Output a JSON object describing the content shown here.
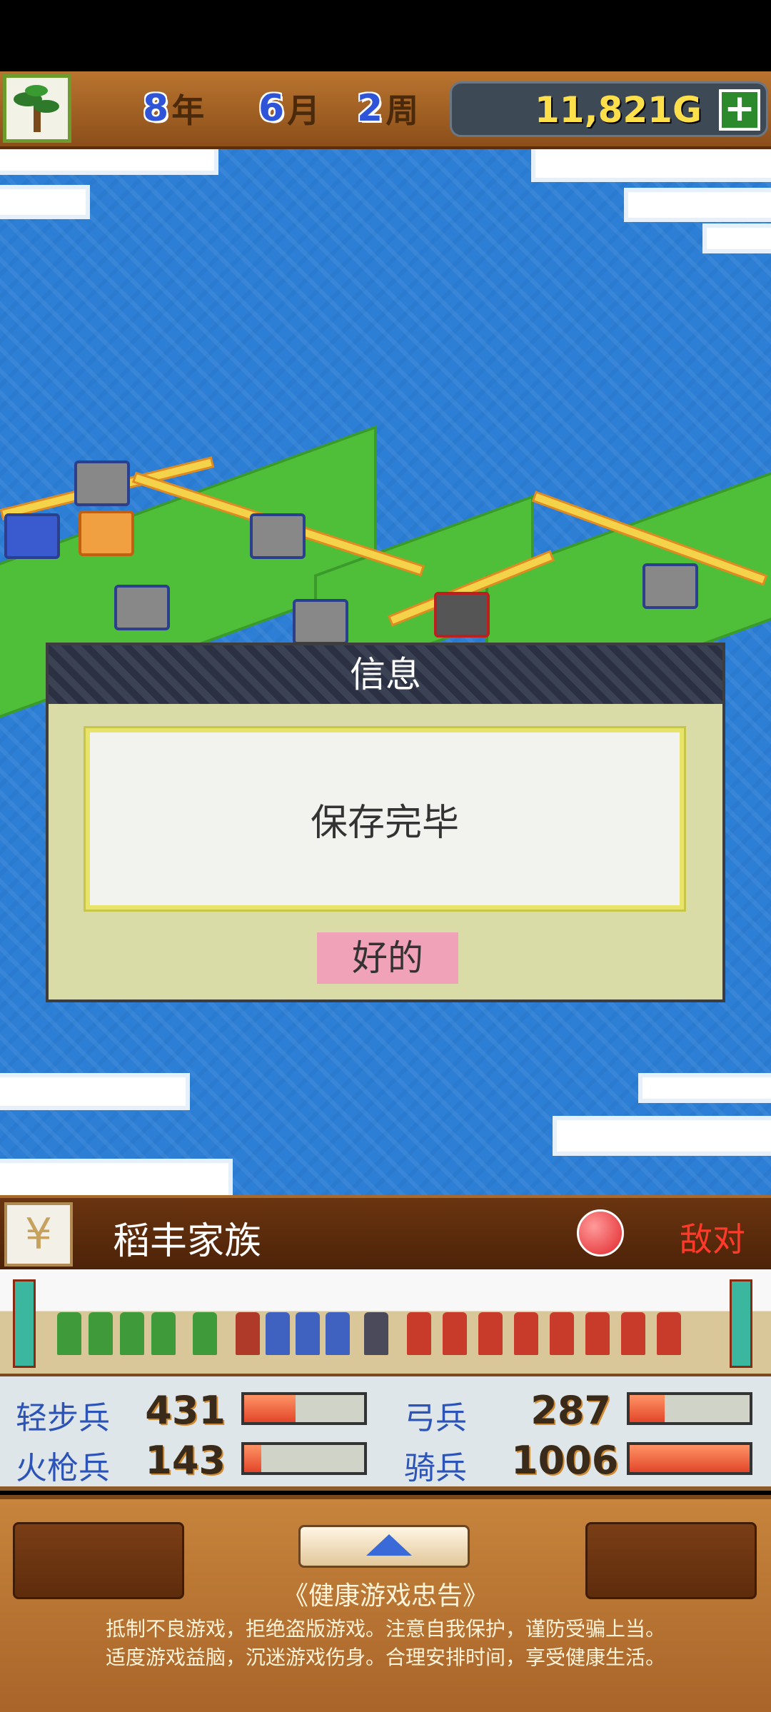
{
  "hud": {
    "year_num": "8",
    "year_unit": "年",
    "month_num": "6",
    "month_unit": "月",
    "week_num": "2",
    "week_unit": "周",
    "gold": "11,821G",
    "add_gold_icon": "plus-icon",
    "emblem_icon": "bonsai-tree-icon"
  },
  "dialog": {
    "title": "信息",
    "message": "保存完毕",
    "ok_label": "好的"
  },
  "clan": {
    "icon": "wheat-icon",
    "name": "稻丰家族",
    "relation_icon": "angry-face-icon",
    "relation": "敌对"
  },
  "troops": [
    {
      "label": "轻步兵",
      "count": "431",
      "fill": 0.43
    },
    {
      "label": "弓兵",
      "count": "287",
      "fill": 0.29
    },
    {
      "label": "火枪兵",
      "count": "143",
      "fill": 0.14
    },
    {
      "label": "骑兵",
      "count": "1006",
      "fill": 1.0
    }
  ],
  "notice": {
    "title": "《健康游戏忠告》",
    "line1": "抵制不良游戏，拒绝盗版游戏。注意自我保护，谨防受骗上当。",
    "line2": "适度游戏益脑，沉迷游戏伤身。合理安排时间，享受健康生活。"
  },
  "colors": {
    "accent_blue": "#2f54d8",
    "gold": "#ffe04a",
    "enemy": "#ff3a2a",
    "ok_button": "#f0a2b8"
  }
}
